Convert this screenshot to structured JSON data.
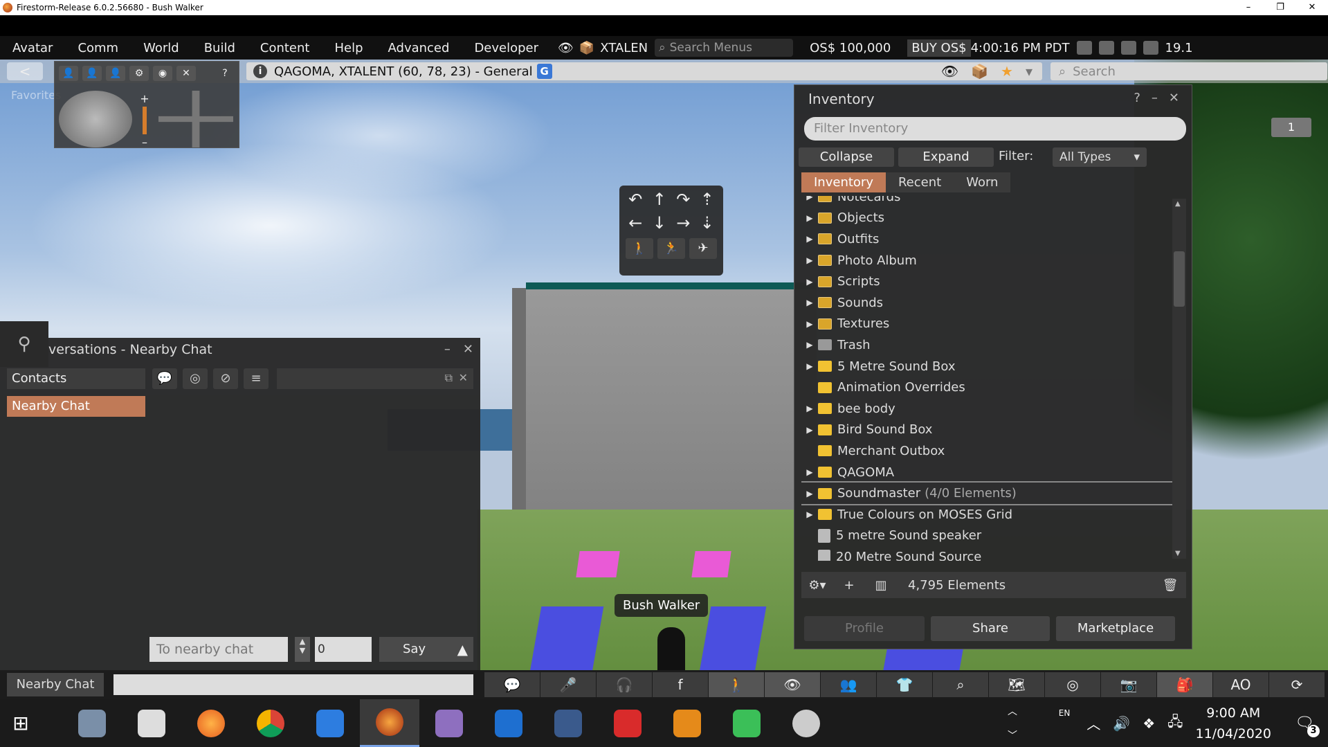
{
  "window": {
    "title": "Firestorm-Release 6.0.2.56680 - Bush Walker",
    "minimize": "–",
    "maximize": "❐",
    "close": "✕"
  },
  "menubar": {
    "items": [
      "Avatar",
      "Comm",
      "World",
      "Build",
      "Content",
      "Help",
      "Advanced",
      "Developer"
    ],
    "region_user": "XTALEN",
    "search_placeholder": "Search Menus",
    "balance": "OS$ 100,000",
    "buy": "BUY OS$",
    "time": "4:00:16 PM PDT",
    "fps": "19.1"
  },
  "navbar": {
    "back": "<",
    "location": "QAGOMA, XTALENT (60, 78, 23) - General",
    "maturity_badge": "G",
    "search_placeholder": "Search",
    "favorites": "Favorites"
  },
  "camera": {
    "help": "?",
    "zoom_plus": "+",
    "zoom_minus": "–"
  },
  "scene": {
    "avatar_name": "Bush Walker",
    "badge": "1"
  },
  "conversations": {
    "title": "versations - Nearby Chat",
    "contacts": "Contacts",
    "nearby_chat": "Nearby Chat",
    "chat_placeholder": "To nearby chat",
    "channel": "0",
    "say": "Say"
  },
  "inventory": {
    "title": "Inventory",
    "help": "?",
    "minimize": "–",
    "close": "✕",
    "filter_placeholder": "Filter Inventory",
    "collapse": "Collapse",
    "expand": "Expand",
    "filter_label": "Filter:",
    "filter_value": "All Types",
    "tabs": [
      "Inventory",
      "Recent",
      "Worn"
    ],
    "items": [
      {
        "label": "Notecards",
        "expandable": true,
        "kind": "sys"
      },
      {
        "label": "Objects",
        "expandable": true,
        "kind": "sys"
      },
      {
        "label": "Outfits",
        "expandable": true,
        "kind": "sys"
      },
      {
        "label": "Photo Album",
        "expandable": true,
        "kind": "sys"
      },
      {
        "label": "Scripts",
        "expandable": true,
        "kind": "sys"
      },
      {
        "label": "Sounds",
        "expandable": true,
        "kind": "sys"
      },
      {
        "label": "Textures",
        "expandable": true,
        "kind": "sys"
      },
      {
        "label": "Trash",
        "expandable": true,
        "kind": "trash"
      },
      {
        "label": "5 Metre Sound Box",
        "expandable": true,
        "kind": "folder"
      },
      {
        "label": "Animation Overrides",
        "expandable": false,
        "kind": "folder"
      },
      {
        "label": "bee body",
        "expandable": true,
        "kind": "folder"
      },
      {
        "label": "Bird Sound Box",
        "expandable": true,
        "kind": "folder"
      },
      {
        "label": "Merchant Outbox",
        "expandable": false,
        "kind": "folder"
      },
      {
        "label": "QAGOMA",
        "expandable": true,
        "kind": "folder"
      },
      {
        "label": "Soundmaster",
        "count": "(4/0 Elements)",
        "expandable": true,
        "kind": "folder",
        "selected": true
      },
      {
        "label": "True Colours on MOSES Grid",
        "expandable": true,
        "kind": "folder"
      },
      {
        "label": "5 metre Sound speaker",
        "expandable": false,
        "kind": "item"
      },
      {
        "label": "20 Metre Sound Source",
        "expandable": false,
        "kind": "item"
      }
    ],
    "element_count": "4,795 Elements",
    "profile": "Profile",
    "share": "Share",
    "marketplace": "Marketplace"
  },
  "bottombar": {
    "nearby_chat": "Nearby Chat"
  },
  "taskbar": {
    "lang": "EN",
    "time": "9:00 AM",
    "date": "11/04/2020",
    "notifications": "3"
  }
}
